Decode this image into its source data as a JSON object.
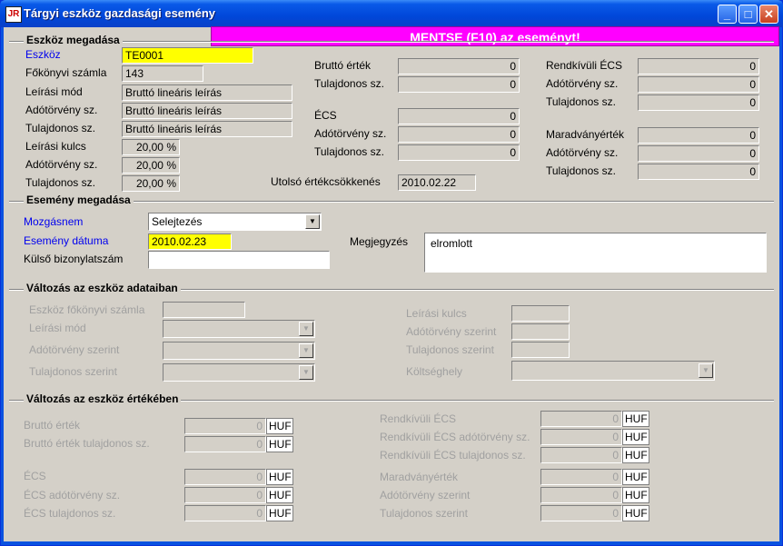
{
  "window": {
    "title": "Tárgyi eszköz gazdasági esemény",
    "app_icon_text": "JR"
  },
  "banner": {
    "label": "MENTSE (F10) az eseményt!"
  },
  "sections": {
    "eszkoz": "Eszköz megadása",
    "esemeny": "Esemény megadása",
    "valtozas_adat": "Változás az eszköz adataiban",
    "valtozas_ertek": "Változás az eszköz értékében"
  },
  "eszkoz": {
    "eszkoz_label": "Eszköz",
    "eszkoz_value": "TE0001",
    "fokonyvi_label": "Főkönyvi számla",
    "fokonyvi_value": "143",
    "leirasi_mod_label": "Leírási mód",
    "leirasi_mod_value": "Bruttó lineáris leírás",
    "adotorveny_label": "Adótörvény sz.",
    "adotorveny_value": "Bruttó lineáris leírás",
    "tulajdonos_label": "Tulajdonos sz.",
    "tulajdonos_value": "Bruttó lineáris leírás",
    "kulcs_label": "Leírási kulcs",
    "kulcs_value": "20,00 %",
    "kulcs_ado_label": "Adótörvény sz.",
    "kulcs_ado_value": "20,00 %",
    "kulcs_tul_label": "Tulajdonos sz.",
    "kulcs_tul_value": "20,00 %",
    "brutto_label": "Bruttó érték",
    "brutto_value": "0",
    "brutto_tul_label": "Tulajdonos sz.",
    "brutto_tul_value": "0",
    "ecs_label": "ÉCS",
    "ecs_value": "0",
    "ecs_ado_label": "Adótörvény sz.",
    "ecs_ado_value": "0",
    "ecs_tul_label": "Tulajdonos sz.",
    "ecs_tul_value": "0",
    "utolso_label": "Utolsó értékcsökkenés",
    "utolso_value": "2010.02.22",
    "rendk_label": "Rendkívüli ÉCS",
    "rendk_value": "0",
    "rendk_ado_label": "Adótörvény sz.",
    "rendk_ado_value": "0",
    "rendk_tul_label": "Tulajdonos sz.",
    "rendk_tul_value": "0",
    "marad_label": "Maradványérték",
    "marad_value": "0",
    "marad_ado_label": "Adótörvény sz.",
    "marad_ado_value": "0",
    "marad_tul_label": "Tulajdonos sz.",
    "marad_tul_value": "0"
  },
  "esemeny": {
    "mozgasnem_label": "Mozgásnem",
    "mozgasnem_value": "Selejtezés",
    "datum_label": "Esemény dátuma",
    "datum_value": "2010.02.23",
    "kulso_label": "Külső bizonylatszám",
    "kulso_value": "",
    "megjegyzes_label": "Megjegyzés",
    "megjegyzes_value": "elromlott"
  },
  "valtozas_adat": {
    "fokonyvi_label": "Eszköz főkönyvi számla",
    "leirasi_mod_label": "Leírási mód",
    "ado_label": "Adótörvény szerint",
    "tul_label": "Tulajdonos szerint",
    "kulcs_label": "Leírási kulcs",
    "kulcs_ado_label": "Adótörvény szerint",
    "kulcs_tul_label": "Tulajdonos szerint",
    "koltseghely_label": "Költséghely"
  },
  "valtozas_ertek": {
    "currency": "HUF",
    "brutto_label": "Bruttó érték",
    "brutto_value": "0",
    "brutto_tul_label": "Bruttó érték tulajdonos sz.",
    "brutto_tul_value": "0",
    "ecs_label": "ÉCS",
    "ecs_value": "0",
    "ecs_ado_label": "ÉCS adótörvény sz.",
    "ecs_ado_value": "0",
    "ecs_tul_label": "ÉCS tulajdonos sz.",
    "ecs_tul_value": "0",
    "rendk_label": "Rendkívüli ÉCS",
    "rendk_value": "0",
    "rendk_ado_label": "Rendkívüli ÉCS adótörvény sz.",
    "rendk_ado_value": "0",
    "rendk_tul_label": "Rendkívüli ÉCS tulajdonos sz.",
    "rendk_tul_value": "0",
    "marad_label": "Maradványérték",
    "marad_value": "0",
    "marad_ado_label": "Adótörvény szerint",
    "marad_ado_value": "0",
    "marad_tul_label": "Tulajdonos szerint",
    "marad_tul_value": "0"
  },
  "titlebar_buttons": {
    "minimize": "_",
    "maximize": "□",
    "close": "✕"
  },
  "dropdown_glyph": "▼"
}
